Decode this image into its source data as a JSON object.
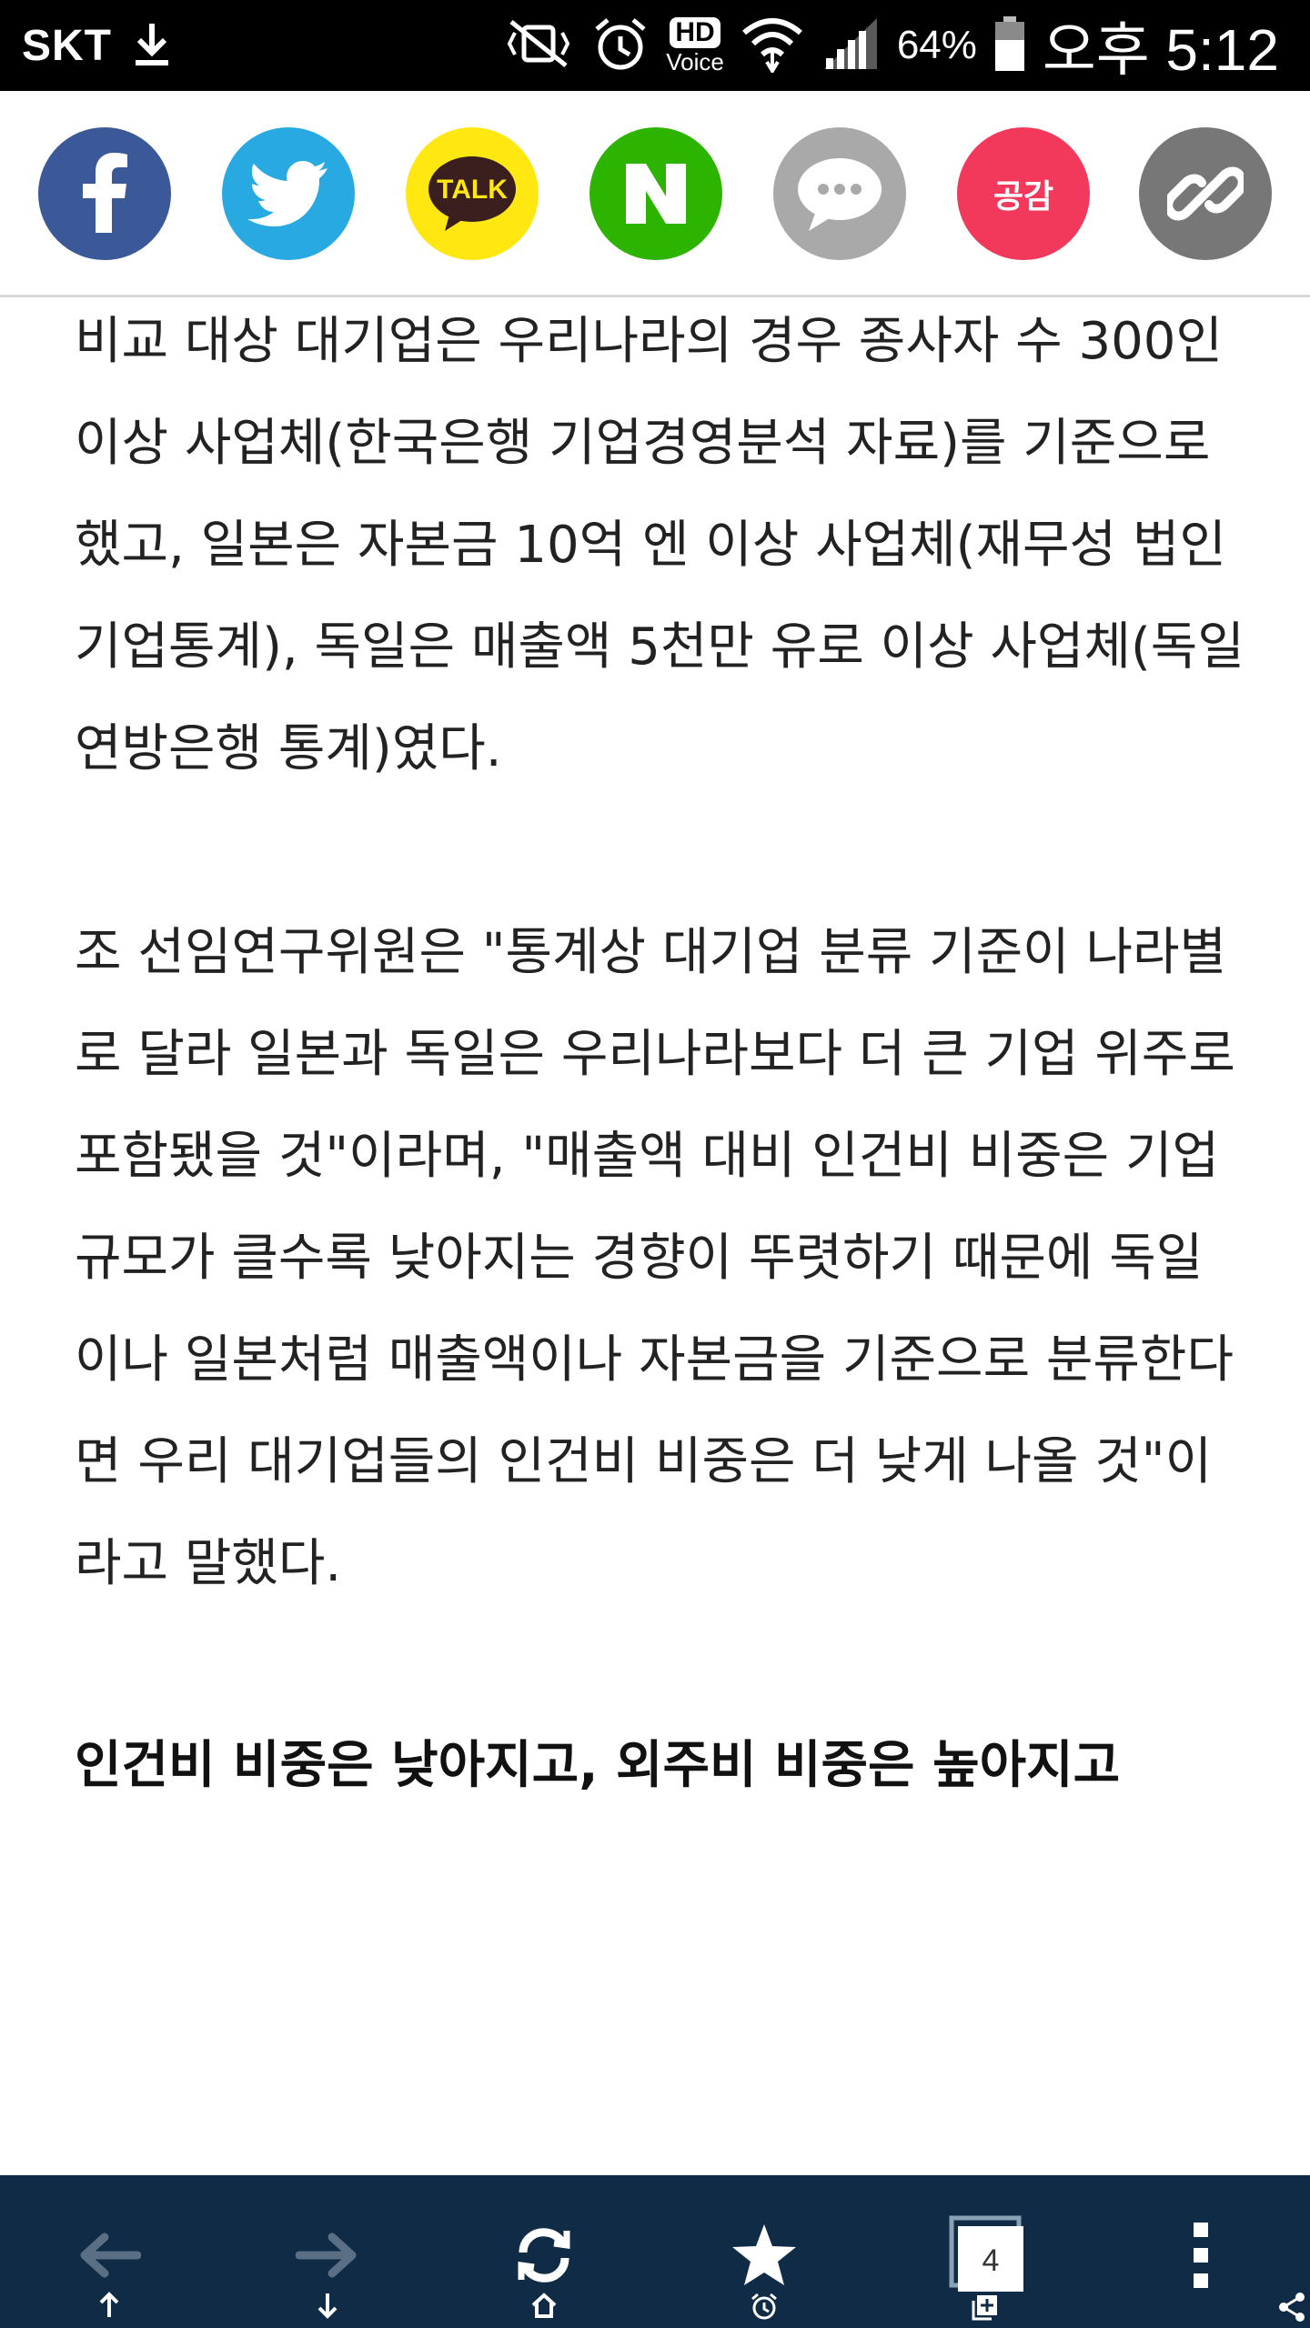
{
  "status_bar": {
    "carrier": "SKT",
    "hd_label": "HD",
    "voice_label": "Voice",
    "battery_percent": "64%",
    "time": "오후 5:12",
    "icons": [
      "download-icon",
      "vibrate-mute-icon",
      "alarm-icon",
      "hd-voice-icon",
      "wifi-icon",
      "signal-icon",
      "battery-icon"
    ]
  },
  "share_bar": {
    "buttons": [
      {
        "name": "facebook",
        "color": "#3b5998"
      },
      {
        "name": "twitter",
        "color": "#29a9e1"
      },
      {
        "name": "kakaotalk",
        "label": "TALK",
        "color": "#ffe812"
      },
      {
        "name": "naver",
        "color": "#2db400"
      },
      {
        "name": "message",
        "color": "#a9a9a9"
      },
      {
        "name": "gonggam",
        "label": "공감",
        "color": "#f2395b"
      },
      {
        "name": "copy-link",
        "color": "#777777"
      }
    ]
  },
  "article": {
    "paragraph1": "비교 대상 대기업은 우리나라의 경우 종사자 수 300인 이상 사업체(한국은행 기업경영분석 자료)를 기준으로 했고, 일본은 자본금 10억 엔 이상 사업체(재무성 법인기업통계), 독일은 매출액 5천만 유로 이상 사업체(독일연방은행 통계)였다.",
    "paragraph2": "조 선임연구위원은 \"통계상 대기업 분류 기준이 나라별로 달라 일본과 독일은 우리나라보다 더 큰 기업 위주로 포함됐을 것\"이라며, \"매출액 대비 인건비 비중은 기업 규모가 클수록 낮아지는 경향이 뚜렷하기 때문에 독일이나 일본처럼 매출액이나 자본금을 기준으로 분류한다면 우리 대기업들의 인건비 비중은 더 낮게 나올 것\"이라고 말했다.",
    "subheading": "인건비 비중은 낮아지고, 외주비 비중은 높아지고"
  },
  "bottom_nav": {
    "tab_count": "4",
    "background": "#0f2b45",
    "items": [
      "back",
      "forward",
      "refresh",
      "bookmark",
      "tabs",
      "menu"
    ],
    "sub_icons": [
      "scroll-up-icon",
      "scroll-down-icon",
      "home-icon",
      "alarm-icon",
      "new-tab-icon",
      "share-icon"
    ]
  }
}
